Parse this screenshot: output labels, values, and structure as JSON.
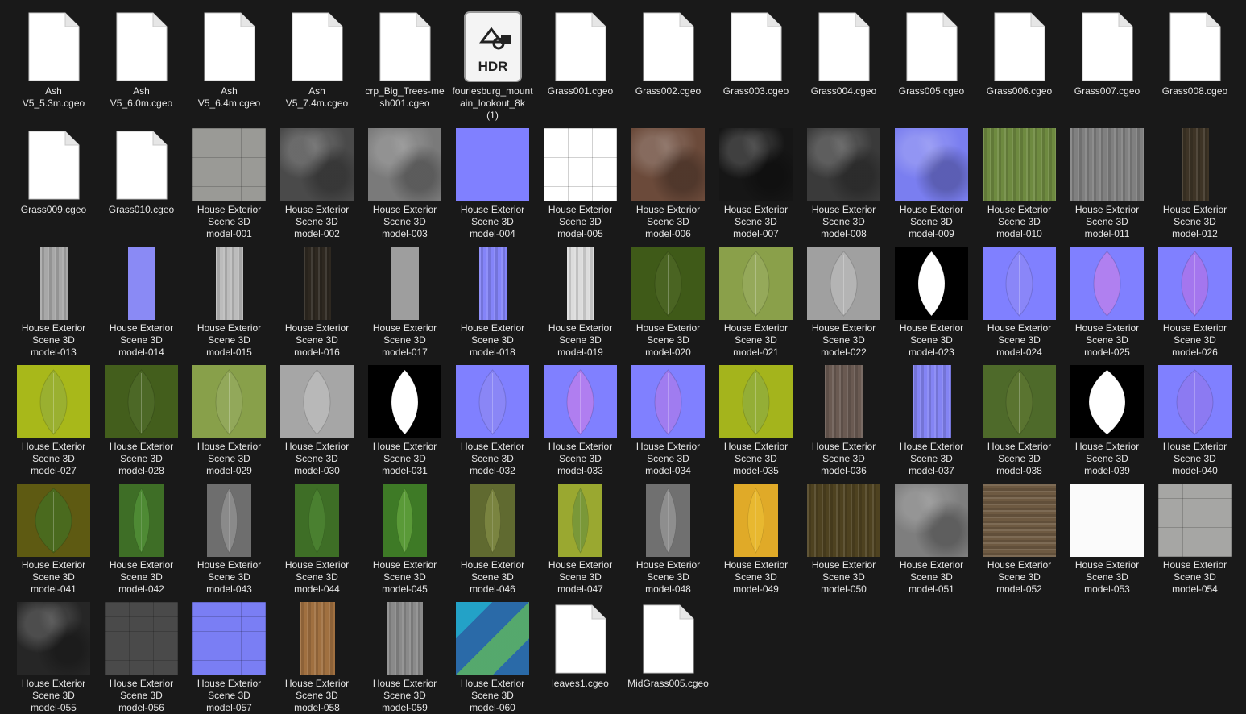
{
  "items": [
    {
      "label": "Ash\nV5_5.3m.cgeo",
      "kind": "file"
    },
    {
      "label": "Ash\nV5_6.0m.cgeo",
      "kind": "file"
    },
    {
      "label": "Ash\nV5_6.4m.cgeo",
      "kind": "file"
    },
    {
      "label": "Ash\nV5_7.4m.cgeo",
      "kind": "file"
    },
    {
      "label": "crp_Big_Trees-mesh001.cgeo",
      "kind": "file"
    },
    {
      "label": "fouriesburg_mountain_lookout_8k\n(1)",
      "kind": "hdr",
      "badge": "HDR"
    },
    {
      "label": "Grass001.cgeo",
      "kind": "file"
    },
    {
      "label": "Grass002.cgeo",
      "kind": "file"
    },
    {
      "label": "Grass003.cgeo",
      "kind": "file"
    },
    {
      "label": "Grass004.cgeo",
      "kind": "file"
    },
    {
      "label": "Grass005.cgeo",
      "kind": "file"
    },
    {
      "label": "Grass006.cgeo",
      "kind": "file"
    },
    {
      "label": "Grass007.cgeo",
      "kind": "file"
    },
    {
      "label": "Grass008.cgeo",
      "kind": "file"
    },
    {
      "label": "Grass009.cgeo",
      "kind": "file"
    },
    {
      "label": "Grass010.cgeo",
      "kind": "file"
    },
    {
      "label": "House Exterior\nScene 3D\nmodel-001",
      "kind": "tex",
      "color": "#9a9a96",
      "pattern": "tiles"
    },
    {
      "label": "House Exterior\nScene 3D\nmodel-002",
      "kind": "tex",
      "color": "#4a4a4a",
      "pattern": "noise"
    },
    {
      "label": "House Exterior\nScene 3D\nmodel-003",
      "kind": "tex",
      "color": "#7a7a7a",
      "pattern": "noise"
    },
    {
      "label": "House Exterior\nScene 3D\nmodel-004",
      "kind": "tex",
      "color": "#8080ff"
    },
    {
      "label": "House Exterior\nScene 3D\nmodel-005",
      "kind": "tex",
      "color": "#ffffff",
      "pattern": "tiles"
    },
    {
      "label": "House Exterior\nScene 3D\nmodel-006",
      "kind": "tex",
      "color": "#6b4a3a",
      "pattern": "noise"
    },
    {
      "label": "House Exterior\nScene 3D\nmodel-007",
      "kind": "tex",
      "color": "#161616",
      "pattern": "noise"
    },
    {
      "label": "House Exterior\nScene 3D\nmodel-008",
      "kind": "tex",
      "color": "#3a3a3a",
      "pattern": "noise"
    },
    {
      "label": "House Exterior\nScene 3D\nmodel-009",
      "kind": "tex",
      "color": "#7a7ef0",
      "pattern": "noise"
    },
    {
      "label": "House Exterior\nScene 3D\nmodel-010",
      "kind": "tex",
      "color": "#6e8a40",
      "pattern": "stripes"
    },
    {
      "label": "House Exterior\nScene 3D\nmodel-011",
      "kind": "tex",
      "color": "#808080",
      "pattern": "stripes"
    },
    {
      "label": "House Exterior\nScene 3D\nmodel-012",
      "kind": "tex",
      "color": "#3e3426",
      "pattern": "stripes",
      "narrow": 34
    },
    {
      "label": "House Exterior\nScene 3D\nmodel-013",
      "kind": "tex",
      "color": "#a8a8a8",
      "pattern": "stripes",
      "narrow": 34
    },
    {
      "label": "House Exterior\nScene 3D\nmodel-014",
      "kind": "tex",
      "color": "#8a8af5",
      "narrow": 34
    },
    {
      "label": "House Exterior\nScene 3D\nmodel-015",
      "kind": "tex",
      "color": "#bcbcbc",
      "pattern": "stripes",
      "narrow": 34
    },
    {
      "label": "House Exterior\nScene 3D\nmodel-016",
      "kind": "tex",
      "color": "#2e2820",
      "pattern": "stripes",
      "narrow": 34
    },
    {
      "label": "House Exterior\nScene 3D\nmodel-017",
      "kind": "tex",
      "color": "#9e9e9e",
      "narrow": 34
    },
    {
      "label": "House Exterior\nScene 3D\nmodel-018",
      "kind": "tex",
      "color": "#8484f8",
      "pattern": "stripes",
      "narrow": 34
    },
    {
      "label": "House Exterior\nScene 3D\nmodel-019",
      "kind": "tex",
      "color": "#dcdcdc",
      "pattern": "stripes",
      "narrow": 34
    },
    {
      "label": "House Exterior\nScene 3D\nmodel-020",
      "kind": "leaf",
      "color": "#3f5a18",
      "leaf": "#4a6422"
    },
    {
      "label": "House Exterior\nScene 3D\nmodel-021",
      "kind": "leaf",
      "color": "#8aa04a",
      "leaf": "#95a95a"
    },
    {
      "label": "House Exterior\nScene 3D\nmodel-022",
      "kind": "leaf",
      "color": "#a0a0a0",
      "leaf": "#b4b4b4"
    },
    {
      "label": "House Exterior\nScene 3D\nmodel-023",
      "kind": "leaf",
      "color": "#000000",
      "leaf": "#ffffff"
    },
    {
      "label": "House Exterior\nScene 3D\nmodel-024",
      "kind": "leaf",
      "color": "#8080ff",
      "leaf": "#8a86f8"
    },
    {
      "label": "House Exterior\nScene 3D\nmodel-025",
      "kind": "leaf",
      "color": "#8080ff",
      "leaf": "#b080f0"
    },
    {
      "label": "House Exterior\nScene 3D\nmodel-026",
      "kind": "leaf",
      "color": "#8080ff",
      "leaf": "#a476ee"
    },
    {
      "label": "House Exterior\nScene 3D\nmodel-027",
      "kind": "leaf",
      "color": "#a8b81a",
      "leaf": "#9ab030"
    },
    {
      "label": "House Exterior\nScene 3D\nmodel-028",
      "kind": "leaf",
      "color": "#435e1c",
      "leaf": "#4c6826"
    },
    {
      "label": "House Exterior\nScene 3D\nmodel-029",
      "kind": "leaf",
      "color": "#88a04a",
      "leaf": "#92a85a"
    },
    {
      "label": "House Exterior\nScene 3D\nmodel-030",
      "kind": "leaf",
      "color": "#a6a6a6",
      "leaf": "#b8b8b8"
    },
    {
      "label": "House Exterior\nScene 3D\nmodel-031",
      "kind": "leaf",
      "color": "#000000",
      "leaf": "#ffffff"
    },
    {
      "label": "House Exterior\nScene 3D\nmodel-032",
      "kind": "leaf",
      "color": "#8080ff",
      "leaf": "#8a86f6"
    },
    {
      "label": "House Exterior\nScene 3D\nmodel-033",
      "kind": "leaf",
      "color": "#8080ff",
      "leaf": "#b07ef0"
    },
    {
      "label": "House Exterior\nScene 3D\nmodel-034",
      "kind": "leaf",
      "color": "#8080ff",
      "leaf": "#a07cf0"
    },
    {
      "label": "House Exterior\nScene 3D\nmodel-035",
      "kind": "leaf",
      "color": "#a4b41c",
      "leaf": "#94ae36"
    },
    {
      "label": "House Exterior\nScene 3D\nmodel-036",
      "kind": "tex",
      "color": "#6a5a52",
      "pattern": "stripes",
      "narrow": 48
    },
    {
      "label": "House Exterior\nScene 3D\nmodel-037",
      "kind": "tex",
      "color": "#8484f4",
      "pattern": "stripes",
      "narrow": 48
    },
    {
      "label": "House Exterior\nScene 3D\nmodel-038",
      "kind": "leaf",
      "color": "#4e6a2a",
      "leaf": "#5a7430"
    },
    {
      "label": "House Exterior\nScene 3D\nmodel-039",
      "kind": "leaf",
      "color": "#000000",
      "leaf": "#ffffff",
      "wide": true
    },
    {
      "label": "House Exterior\nScene 3D\nmodel-040",
      "kind": "leaf",
      "color": "#8080ff",
      "leaf": "#8c7af2",
      "wide": true
    },
    {
      "label": "House Exterior\nScene 3D\nmodel-041",
      "kind": "leaf",
      "color": "#5e5a12",
      "leaf": "#4a6a1e",
      "wide": true
    },
    {
      "label": "House Exterior\nScene 3D\nmodel-042",
      "kind": "leaf",
      "color": "#3e6e26",
      "leaf": "#4e8a34",
      "narrow": 55
    },
    {
      "label": "House Exterior\nScene 3D\nmodel-043",
      "kind": "leaf",
      "color": "#6e6e6e",
      "leaf": "#8a8a8a",
      "narrow": 55
    },
    {
      "label": "House Exterior\nScene 3D\nmodel-044",
      "kind": "leaf",
      "color": "#3e6e26",
      "leaf": "#4a8030",
      "narrow": 55
    },
    {
      "label": "House Exterior\nScene 3D\nmodel-045",
      "kind": "leaf",
      "color": "#3e7a26",
      "leaf": "#5a9a38",
      "narrow": 55
    },
    {
      "label": "House Exterior\nScene 3D\nmodel-046",
      "kind": "leaf",
      "color": "#606a30",
      "leaf": "#7a8440",
      "narrow": 55
    },
    {
      "label": "House Exterior\nScene 3D\nmodel-047",
      "kind": "leaf",
      "color": "#9aa830",
      "leaf": "#7a9838",
      "narrow": 55
    },
    {
      "label": "House Exterior\nScene 3D\nmodel-048",
      "kind": "leaf",
      "color": "#707070",
      "leaf": "#8e8e8e",
      "narrow": 55
    },
    {
      "label": "House Exterior\nScene 3D\nmodel-049",
      "kind": "leaf",
      "color": "#e0aa28",
      "leaf": "#e8b830",
      "narrow": 55
    },
    {
      "label": "House Exterior\nScene 3D\nmodel-050",
      "kind": "tex",
      "color": "#4e4220",
      "pattern": "stripes"
    },
    {
      "label": "House Exterior\nScene 3D\nmodel-051",
      "kind": "tex",
      "color": "#7e7e7e",
      "pattern": "noise"
    },
    {
      "label": "House Exterior\nScene 3D\nmodel-052",
      "kind": "tex",
      "color": "#6e5a42",
      "pattern": "hstripes"
    },
    {
      "label": "House Exterior\nScene 3D\nmodel-053",
      "kind": "tex",
      "color": "#fbfbfb"
    },
    {
      "label": "House Exterior\nScene 3D\nmodel-054",
      "kind": "tex",
      "color": "#a6a6a4",
      "pattern": "tiles"
    },
    {
      "label": "House Exterior\nScene 3D\nmodel-055",
      "kind": "tex",
      "color": "#262626",
      "pattern": "noise"
    },
    {
      "label": "House Exterior\nScene 3D\nmodel-056",
      "kind": "tex",
      "color": "#4a4a4a",
      "pattern": "tiles"
    },
    {
      "label": "House Exterior\nScene 3D\nmodel-057",
      "kind": "tex",
      "color": "#7a7ef4",
      "pattern": "tiles"
    },
    {
      "label": "House Exterior\nScene 3D\nmodel-058",
      "kind": "tex",
      "color": "#a07040",
      "pattern": "stripes",
      "narrow": 44
    },
    {
      "label": "House Exterior\nScene 3D\nmodel-059",
      "kind": "tex",
      "color": "#8a8a8a",
      "pattern": "stripes",
      "narrow": 44
    },
    {
      "label": "House Exterior\nScene 3D\nmodel-060",
      "kind": "tex",
      "color": "#2a6aa8",
      "pattern": "checker"
    },
    {
      "label": "leaves1.cgeo",
      "kind": "file"
    },
    {
      "label": "MidGrass005.cgeo",
      "kind": "file"
    }
  ]
}
